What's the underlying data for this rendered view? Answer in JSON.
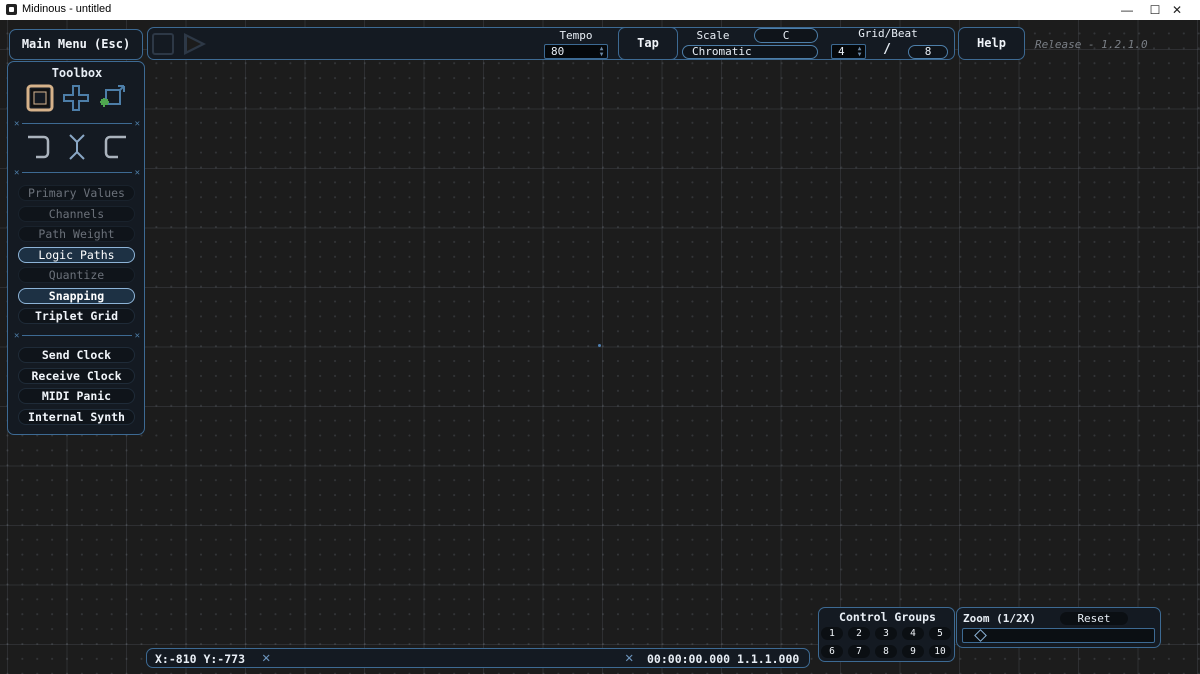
{
  "window": {
    "title": "Midinous - untitled",
    "minimize": "—",
    "maximize": "☐",
    "close": "✕"
  },
  "header": {
    "main_menu": "Main Menu (Esc)",
    "tempo_label": "Tempo",
    "tempo_value": "80",
    "tap": "Tap",
    "scale_label": "Scale",
    "scale_key": "C",
    "scale_mode": "Chromatic",
    "grid_label": "Grid/Beat",
    "grid_num": "4",
    "grid_sep": "/",
    "grid_den": "8",
    "help": "Help",
    "release": "Release - 1.2.1.0"
  },
  "toolbox": {
    "title": "Toolbox",
    "tools": [
      "select-tool",
      "add-point-tool",
      "path-tool"
    ],
    "edit_tools": [
      "undo",
      "cut",
      "redo"
    ],
    "options": [
      {
        "label": "Primary Values",
        "state": "disabled"
      },
      {
        "label": "Channels",
        "state": "disabled"
      },
      {
        "label": "Path Weight",
        "state": "disabled"
      },
      {
        "label": "Logic Paths",
        "state": "on"
      },
      {
        "label": "Quantize",
        "state": "disabled"
      },
      {
        "label": "Snapping",
        "state": "on"
      },
      {
        "label": "Triplet Grid",
        "state": "off"
      }
    ],
    "midi": [
      "Send Clock",
      "Receive Clock",
      "MIDI Panic",
      "Internal Synth"
    ]
  },
  "status": {
    "coords": "X:-810 Y:-773",
    "timecode": "00:00:00.000 1.1.1.000"
  },
  "control_groups": {
    "title": "Control Groups",
    "items": [
      "1",
      "2",
      "3",
      "4",
      "5",
      "6",
      "7",
      "8",
      "9",
      "10"
    ]
  },
  "zoom": {
    "label": "Zoom (1/2X)",
    "reset": "Reset",
    "level": 0.06
  },
  "colors": {
    "accent": "#3d6a93",
    "active": "#8db4d8",
    "tool_select": "#d6b28a",
    "tool_blue": "#4d7ea8",
    "tool_green": "#4fa64f"
  }
}
